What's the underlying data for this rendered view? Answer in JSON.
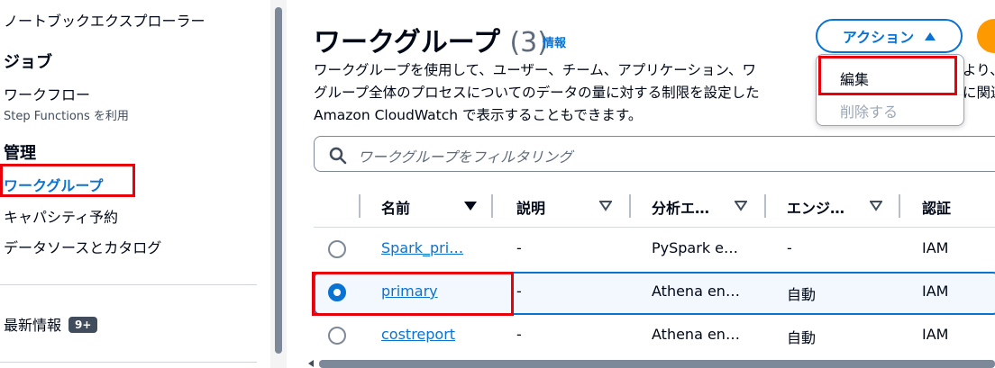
{
  "sidebar": {
    "notebook_explorer": "ノートブックエクスプローラー",
    "jobs_heading": "ジョブ",
    "workflow": "ワークフロー",
    "workflow_sub": "Step Functions を利用",
    "admin_heading": "管理",
    "workgroups": "ワークグループ",
    "capacity": "キャパシティ予約",
    "datasources": "データソースとカタログ",
    "whats_new": "最新情報",
    "whats_new_badge": "9+"
  },
  "header": {
    "title": "ワークグループ",
    "count": "(3)",
    "info": "情報",
    "description_lines": [
      "ワークグループを使用して、ユーザー、チーム、アプリケーション、ワ",
      "グループ全体のプロセスについてのデータの量に対する制限を設定した",
      "Amazon CloudWatch で表示することもできます。"
    ],
    "description_right_fragments": [
      "より、",
      "に関連"
    ]
  },
  "actions": {
    "label": "アクション",
    "menu": [
      "編集",
      "削除する"
    ]
  },
  "search": {
    "placeholder": "ワークグループをフィルタリング"
  },
  "table": {
    "columns": [
      "名前",
      "説明",
      "分析エ…",
      "エンジ…",
      "認証"
    ],
    "rows": [
      {
        "name": "Spark_pri…",
        "description": "-",
        "analytics": "PySpark e…",
        "engine": "-",
        "auth": "IAM",
        "selected": false
      },
      {
        "name": "primary",
        "description": "-",
        "analytics": "Athena en…",
        "engine": "自動",
        "auth": "IAM",
        "selected": true
      },
      {
        "name": "costreport",
        "description": "-",
        "analytics": "Athena en…",
        "engine": "自動",
        "auth": "IAM",
        "selected": false
      }
    ]
  },
  "colors": {
    "accent": "#0972d3",
    "highlight_box": "#e8000b",
    "primary_orange": "#ff9900"
  }
}
